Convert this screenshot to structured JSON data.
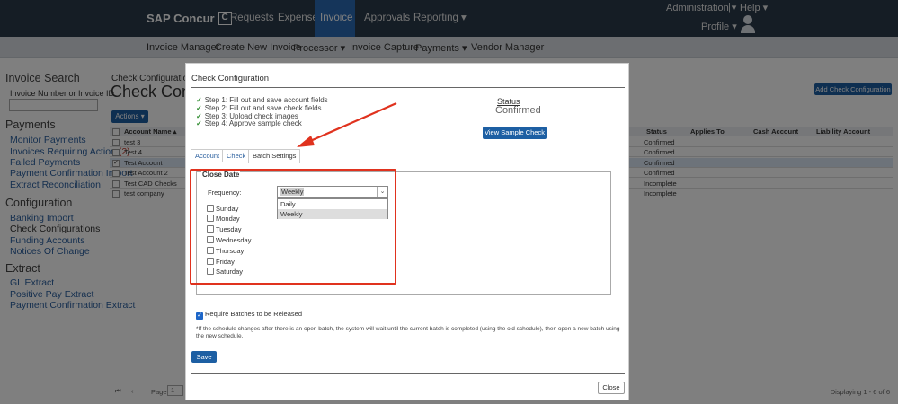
{
  "topbar": {
    "logo_text": "SAP Concur",
    "logo_mark": "C",
    "nav": [
      "Requests",
      "Expense",
      "Invoice",
      "Approvals",
      "Reporting ▾"
    ],
    "active_nav": "Invoice",
    "administration": "Administration ▾",
    "separator": "|",
    "help": "Help ▾",
    "profile": "Profile ▾"
  },
  "subnav": {
    "items": [
      "Invoice Manager",
      "Create New Invoice",
      "Processor ▾",
      "Invoice Capture",
      "Payments ▾",
      "Vendor Manager"
    ]
  },
  "sidebar": {
    "invoice_search_heading": "Invoice Search",
    "invoice_number_label": "Invoice Number or Invoice ID",
    "payments_heading": "Payments",
    "payments_links": [
      "Monitor Payments",
      "Invoices Requiring Action",
      "Failed Payments",
      "Payment Confirmation Import",
      "Extract Reconciliation"
    ],
    "action_count": "(2)",
    "configuration_heading": "Configuration",
    "configuration_links": [
      "Banking Import",
      "Check Configurations",
      "Funding Accounts",
      "Notices Of Change"
    ],
    "extract_heading": "Extract",
    "extract_links": [
      "GL Extract",
      "Positive Pay Extract",
      "Payment Confirmation Extract"
    ]
  },
  "page": {
    "breadcrumb": "Check Configurations",
    "title": "Check Conc",
    "actions_label": "Actions ▾",
    "add_button": "Add Check Configuration",
    "grid_left_header": "Account Name ▴",
    "grid_left_rows": [
      "test 3",
      "Test 4",
      "Test Account",
      "Test Account 2",
      "Test CAD Checks",
      "test company"
    ],
    "selected_row": 2,
    "grid_right_headers": [
      "Status",
      "Applies To",
      "Cash Account",
      "Liability Account"
    ],
    "grid_right_statuses": [
      "Confirmed",
      "Confirmed",
      "Confirmed",
      "Confirmed",
      "Incomplete",
      "Incomplete"
    ],
    "pager_label": "Page",
    "pager_value": "1",
    "displaying": "Displaying 1 - 6 of 6"
  },
  "modal": {
    "title": "Check Configuration",
    "steps": [
      "Step 1: Fill out and save account fields",
      "Step 2: Fill out and save check fields",
      "Step 3: Upload check images",
      "Step 4: Approve sample check"
    ],
    "step_icon": "✓",
    "status_label": "Status",
    "status_value": "Confirmed",
    "sample_button": "View Sample Check",
    "tabs": [
      "Account",
      "Check",
      "Batch Settings"
    ],
    "active_tab": "Batch Settings",
    "close_date_legend": "Close Date",
    "frequency_label": "Frequency:",
    "frequency_value": "Weekly",
    "frequency_options": [
      "Daily",
      "Weekly"
    ],
    "days": [
      "Sunday",
      "Monday",
      "Tuesday",
      "Wednesday",
      "Thursday",
      "Friday",
      "Saturday"
    ],
    "require_batches_label": "Require Batches to be Released",
    "require_batches_checked": true,
    "note": "*If the schedule changes after there is an open batch, the system will wait until the current batch is completed (using the old schedule), then open a new batch using the new schedule.",
    "save_button": "Save",
    "close_button": "Close"
  },
  "colors": {
    "topbar_bg": "#2b3b4b",
    "active_nav_bg": "#2a6bb5",
    "primary_button": "#1d5fa3",
    "highlight_red": "#e0321e"
  }
}
